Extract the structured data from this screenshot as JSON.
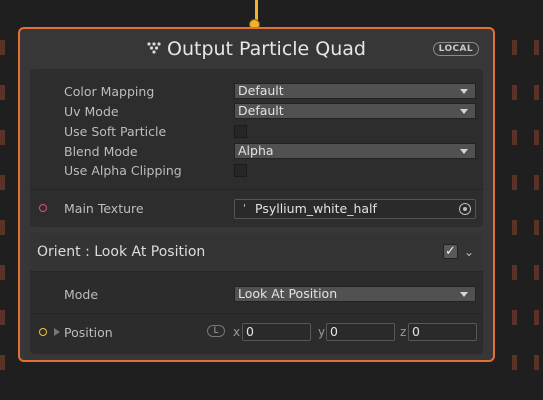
{
  "node": {
    "title": "Output Particle Quad",
    "badge": "LOCAL",
    "accent_color": "#e36f35",
    "title_icon": "vfx-context-icon"
  },
  "settings": {
    "color_mapping": {
      "label": "Color Mapping",
      "value": "Default"
    },
    "uv_mode": {
      "label": "Uv Mode",
      "value": "Default"
    },
    "use_soft_particle": {
      "label": "Use Soft Particle",
      "checked": false
    },
    "blend_mode": {
      "label": "Blend Mode",
      "value": "Alpha"
    },
    "use_alpha_clipping": {
      "label": "Use Alpha Clipping",
      "checked": false
    }
  },
  "main_texture": {
    "label": "Main Texture",
    "prefix": "'",
    "value": "Psyllium_white_half",
    "port_color": "#e2526b"
  },
  "orient_block": {
    "title": "Orient : Look At Position",
    "enabled": true,
    "mode": {
      "label": "Mode",
      "value": "Look At Position"
    },
    "position": {
      "label": "Position",
      "space_badge": "L",
      "x_label": "x",
      "x": "0",
      "y_label": "y",
      "y": "0",
      "z_label": "z",
      "z": "0",
      "port_color": "#f2c33a"
    }
  },
  "connector_color": "#f2b324"
}
